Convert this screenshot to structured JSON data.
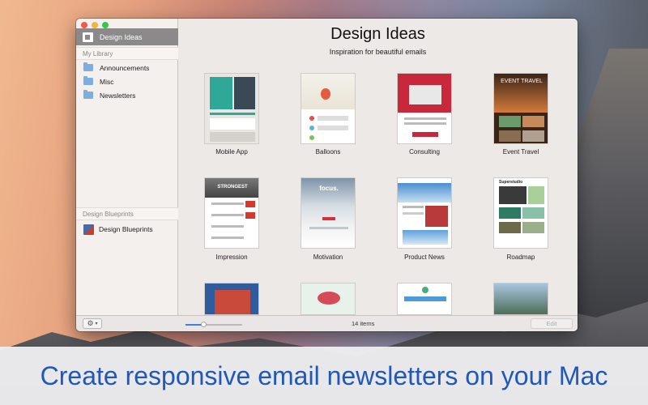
{
  "window": {
    "title": "Design Ideas"
  },
  "sidebar": {
    "selected": {
      "label": "Design Ideas",
      "icon": "template-icon"
    },
    "my_library": {
      "heading": "My Library",
      "items": [
        {
          "label": "Announcements",
          "icon": "folder-icon"
        },
        {
          "label": "Misc",
          "icon": "folder-icon"
        },
        {
          "label": "Newsletters",
          "icon": "folder-icon"
        }
      ]
    },
    "blueprints": {
      "heading": "Design Blueprints",
      "items": [
        {
          "label": "Design Blueprints",
          "icon": "blueprint-icon"
        }
      ]
    }
  },
  "main": {
    "title": "Design Ideas",
    "subtitle": "Inspiration for beautiful emails",
    "templates": [
      {
        "label": "Mobile App"
      },
      {
        "label": "Balloons"
      },
      {
        "label": "Consulting"
      },
      {
        "label": "Event Travel",
        "thumb_text": "EVENT TRAVEL"
      },
      {
        "label": "Impression",
        "thumb_text": "STRONGEST"
      },
      {
        "label": "Motivation",
        "thumb_text": "focus."
      },
      {
        "label": "Product News"
      },
      {
        "label": "Roadmap",
        "thumb_text": "Superstudio"
      },
      {
        "label": ""
      },
      {
        "label": ""
      },
      {
        "label": ""
      },
      {
        "label": ""
      }
    ]
  },
  "footer": {
    "settings_icon": "gear-icon",
    "zoom_level": 0.33,
    "item_count": "14 items",
    "edit_label": "Edit"
  },
  "banner": {
    "text": "Create responsive email newsletters on your Mac"
  }
}
